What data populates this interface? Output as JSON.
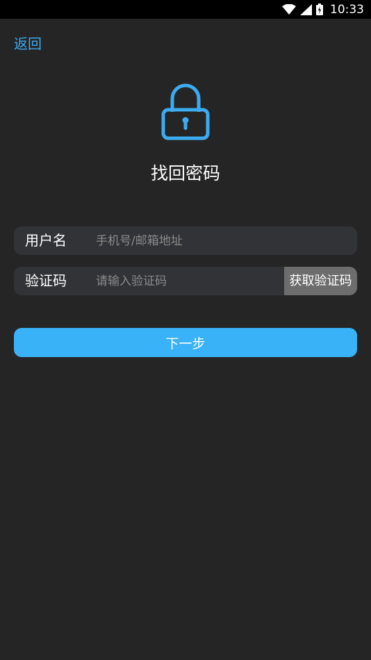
{
  "status_bar": {
    "time": "10:33",
    "icons": [
      "wifi-icon",
      "signal-icon",
      "battery-icon"
    ]
  },
  "header": {
    "back_label": "返回"
  },
  "hero": {
    "icon": "lock-icon",
    "title": "找回密码"
  },
  "form": {
    "username": {
      "label": "用户名",
      "value": "",
      "placeholder": "手机号/邮箱地址"
    },
    "code": {
      "label": "验证码",
      "value": "",
      "placeholder": "请输入验证码",
      "get_code_label": "获取验证码"
    },
    "next_label": "下一步"
  },
  "colors": {
    "accent": "#3ab2f7",
    "background": "#252525",
    "field_background": "#323336",
    "get_code_button": "#6d6d6d",
    "status_bar": "#000000"
  }
}
